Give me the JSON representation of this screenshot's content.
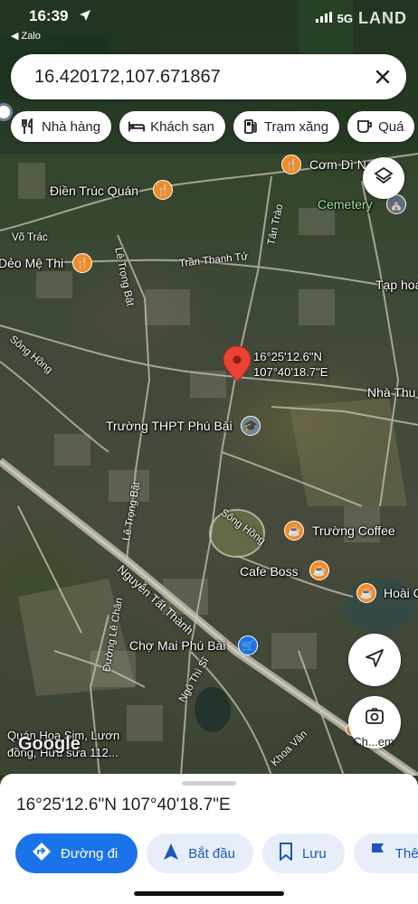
{
  "status_bar": {
    "time": "16:39",
    "back_app": "◀ Zalo",
    "watermark": "LAND",
    "signal": "5G"
  },
  "search": {
    "value": "16.420172,107.671867",
    "clear_icon": "close-icon"
  },
  "chips": [
    {
      "label": "Nhà hàng",
      "icon": "restaurant-icon"
    },
    {
      "label": "Khách sạn",
      "icon": "hotel-icon"
    },
    {
      "label": "Trạm xăng",
      "icon": "gas-station-icon"
    },
    {
      "label": "Quá",
      "icon": "coffee-icon"
    }
  ],
  "map": {
    "pin_label_lat": "16°25'12.6\"N",
    "pin_label_lng": "107°40'18.7\"E",
    "places": {
      "com_di": "Cơm Dì N",
      "dien_truc_quan": "Điền Trúc Quán",
      "cemetery": "Cemetery",
      "deo_me_thi": "Dẻo Mệ Thi",
      "tap_hoa": "Tạp hoá",
      "nha_thu": "Nhà Thu",
      "truong_thpt": "Trường THPT Phú Bài",
      "truong_coffee": "Trường Coffee",
      "cafe_boss": "Cafe Boss",
      "hoai_c": "Hoài C",
      "cho_mai": "Chợ Mai Phú Bài",
      "quan_hoa_sim": "Quán Hoa Sim, Lươn",
      "dong_huu_sua": "đồng, Hữu sữa 112..."
    },
    "roads": {
      "vo_trac": "Võ Trác",
      "le_trong_bat_1": "Lê Trọng Bật",
      "le_trong_bat_2": "Lê Trọng Bật",
      "tan_trao": "Tân Trào",
      "tran_thanh_tu": "Trần Thanh Tứ",
      "song_hong_1": "Sông Hồng",
      "song_hong_2": "Sông Hồng",
      "nguyen_tat_thanh": "Nguyễn Tất Thành",
      "duong_le_chan": "Đường Lê Chân",
      "ngo_thi_si": "Ngô Thì Sĩ",
      "khoa_van": "Khoa Văn"
    },
    "google_logo": "Google",
    "lens_label": "Ch...em"
  },
  "bottom_sheet": {
    "coords": "16°25'12.6\"N 107°40'18.7\"E",
    "actions": [
      {
        "label": "Đường đi",
        "icon": "directions-icon"
      },
      {
        "label": "Bắt đầu",
        "icon": "navigation-arrow-icon"
      },
      {
        "label": "Lưu",
        "icon": "bookmark-icon"
      },
      {
        "label": "Thên",
        "icon": "flag-icon"
      }
    ]
  },
  "colors": {
    "accent": "#1a73e8",
    "pin": "#ea4335",
    "poi_orange": "#f28b22",
    "chip_bg": "#ffffff"
  }
}
